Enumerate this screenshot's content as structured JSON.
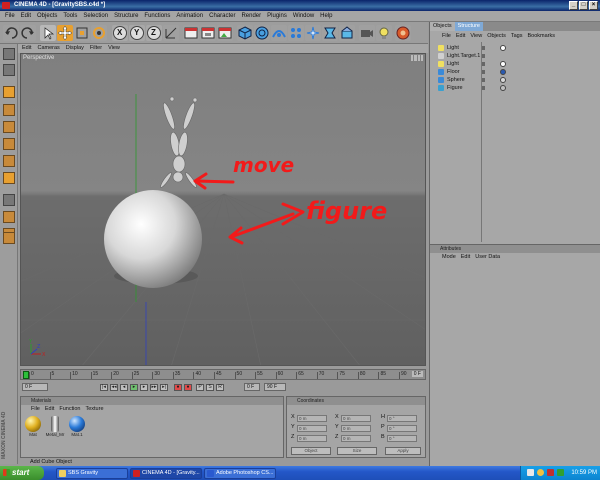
{
  "window": {
    "title": "CINEMA 4D - [GravitySBS.c4d *]",
    "buttons": [
      "_",
      "□",
      "×"
    ]
  },
  "menubar": [
    "File",
    "Edit",
    "Objects",
    "Tools",
    "Selection",
    "Structure",
    "Functions",
    "Animation",
    "Character",
    "Render",
    "Plugins",
    "Window",
    "Help"
  ],
  "toolbar": {
    "axis_buttons": [
      "X",
      "Y",
      "Z"
    ]
  },
  "viewport": {
    "menu": [
      "Edit",
      "Cameras",
      "Display",
      "Filter",
      "View"
    ],
    "label": "Perspective",
    "annotation": [
      "move",
      "figure"
    ],
    "axes": {
      "x": "X",
      "y": "Y",
      "z": "Z"
    }
  },
  "timeline": {
    "tick_labels": [
      "0",
      "5",
      "10",
      "15",
      "20",
      "25",
      "30",
      "35",
      "40",
      "45",
      "50",
      "55",
      "60",
      "65",
      "70",
      "75",
      "80",
      "85",
      "90"
    ],
    "end_value": "0 F",
    "start_field": "0 F",
    "current_field": "0 F",
    "end_field": "90 F"
  },
  "materials": {
    "title": "Materials",
    "menu": [
      "File",
      "Edit",
      "Function",
      "Texture"
    ],
    "items": [
      {
        "label": "Mat",
        "color": "#e0b020"
      },
      {
        "label": "Metal_Mr",
        "color": "#d8d8d8"
      },
      {
        "label": "Mat.1",
        "color": "#2a7ad8"
      }
    ]
  },
  "coordinates": {
    "title": "Coordinates",
    "rows": [
      {
        "a": "X",
        "a_val": "0 m",
        "b": "X",
        "b_val": "0 m",
        "c": "H",
        "c_val": "0 °"
      },
      {
        "a": "Y",
        "a_val": "0 m",
        "b": "Y",
        "b_val": "0 m",
        "c": "P",
        "c_val": "0 °"
      },
      {
        "a": "Z",
        "a_val": "0 m",
        "b": "Z",
        "b_val": "0 m",
        "c": "B",
        "c_val": "0 °"
      }
    ],
    "mode_select": "Object",
    "size_select": "Size",
    "apply_label": "Apply"
  },
  "status": "Add Cube Object",
  "objects": {
    "tabs": [
      "Objects",
      "Structure"
    ],
    "menu": [
      "File",
      "Edit",
      "View",
      "Objects",
      "Tags",
      "Bookmarks"
    ],
    "items": [
      {
        "name": "Light",
        "icon_color": "#f0e060",
        "tag": "#ffffff"
      },
      {
        "name": "Light.Target.1",
        "icon_color": "#d0d0d0",
        "tag": ""
      },
      {
        "name": "Light",
        "icon_color": "#f0e060",
        "tag": "#ffffff"
      },
      {
        "name": "Floor",
        "icon_color": "#3a8ad8",
        "tag": "#2a5ab0"
      },
      {
        "name": "Sphere",
        "icon_color": "#3a8ad8",
        "tag": "#d8d8d8"
      },
      {
        "name": "Figure",
        "icon_color": "#3aa0d0",
        "tag": "#c0c0c0"
      }
    ]
  },
  "attributes": {
    "title": "Attributes",
    "menu": [
      "Mode",
      "Edit",
      "User Data"
    ]
  },
  "taskbar": {
    "start": "start",
    "tasks": [
      {
        "label": "SBS Gravity",
        "icon": "#f0d060"
      },
      {
        "label": "CINEMA 4D - [Gravity...",
        "icon": "#d02020"
      },
      {
        "label": "Adobe Photoshop CS...",
        "icon": "#2a5ad0"
      }
    ],
    "clock": "10:59 PM"
  }
}
